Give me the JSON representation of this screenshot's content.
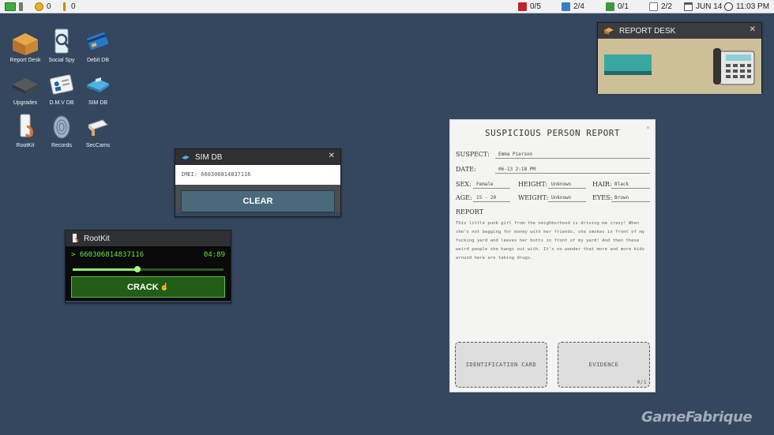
{
  "topbar": {
    "left": [
      {
        "icon": "computer-icon",
        "value": ""
      },
      {
        "icon": "coin-icon",
        "value": "0"
      },
      {
        "icon": "key-icon",
        "value": "0"
      }
    ],
    "right": [
      {
        "icon": "flag-icon",
        "value": "0/5"
      },
      {
        "icon": "document-icon",
        "value": "2/4"
      },
      {
        "icon": "folder-icon",
        "value": "0/1"
      },
      {
        "icon": "clipboard-icon",
        "value": "2/2"
      }
    ],
    "date": "JUN 14",
    "time": "11:03 PM"
  },
  "desktop_icons": [
    {
      "label": "Report Desk",
      "icon": "desk-icon"
    },
    {
      "label": "Social Spy",
      "icon": "magnifier-phone-icon"
    },
    {
      "label": "Debit DB",
      "icon": "credit-card-icon"
    },
    {
      "label": "Upgrades",
      "icon": "chip-icon"
    },
    {
      "label": "D.M.V DB",
      "icon": "id-card-icon"
    },
    {
      "label": "SIM DB",
      "icon": "sim-card-icon"
    },
    {
      "label": "RootKit",
      "icon": "phone-hook-icon"
    },
    {
      "label": "Records",
      "icon": "fingerprint-icon"
    },
    {
      "label": "SecCams",
      "icon": "camera-icon"
    }
  ],
  "simdb": {
    "title": "SIM DB",
    "imei_text": "IMEI: 660306814837116",
    "clear_label": "CLEAR"
  },
  "rootkit": {
    "title": "RootKit",
    "code": "> 660306814837116",
    "timer": "04:89",
    "progress": 0.43,
    "crack_label": "CRACK"
  },
  "report_desk": {
    "title": "REPORT DESK"
  },
  "report": {
    "title": "SUSPICIOUS PERSON REPORT",
    "suspect_label": "SUSPECT:",
    "suspect_value": "Emma Pierson",
    "date_label": "DATE:",
    "date_value": "06-13 2:18 PM",
    "sex_label": "SEX:",
    "sex_value": "Female",
    "height_label": "HEIGHT:",
    "height_value": "Unknown",
    "hair_label": "HAIR:",
    "hair_value": "Black",
    "age_label": "AGE:",
    "age_value": "15 - 20",
    "weight_label": "WEIGHT:",
    "weight_value": "Unknown",
    "eyes_label": "EYES:",
    "eyes_value": "Brown",
    "report_label": "REPORT",
    "report_text": "This little punk girl from the neighborhood is driving me crazy! When she's not begging for money with her friends, she smokes in front of my fucking yard and leaves her butts in front of my yard! And then these weird people she hangs out with. It's no wonder that more and more kids around here are taking drugs.",
    "id_card_slot": "IDENTIFICATION CARD",
    "evidence_slot": "EVIDENCE",
    "evidence_count": "0/1"
  },
  "watermark": "GameFabrique",
  "colors": {
    "desktop": "#34475f",
    "rootkit_green": "#6be34b",
    "button_blue": "#4a6a7b"
  }
}
